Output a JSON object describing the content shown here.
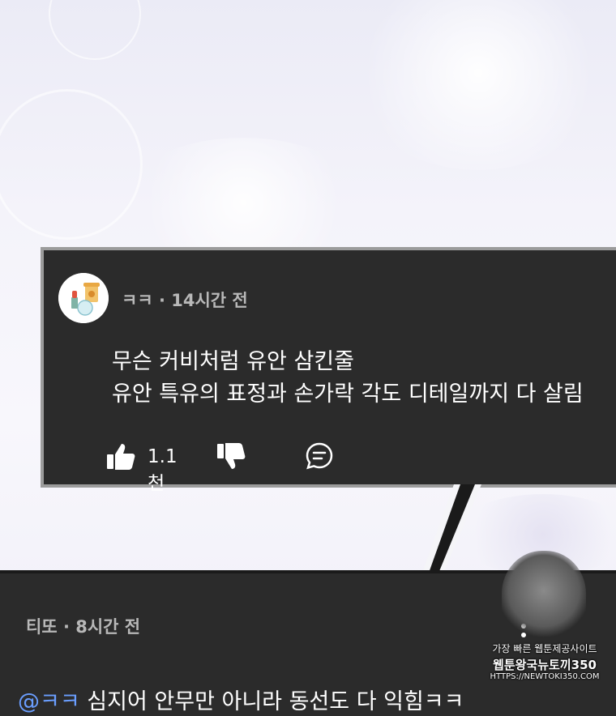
{
  "comments": [
    {
      "author": "ㅋㅋ",
      "time": "· 14시간 전",
      "lines": [
        "무슨 커비처럼 유안 삼킨줄",
        "유안 특유의 표정과 손가락 각도 디테일까지 다 살림"
      ],
      "likes": "1.1천",
      "icons": [
        "avatar-snacks-icon",
        "thumbs-up-icon",
        "thumbs-down-icon",
        "reply-bubble-icon"
      ]
    },
    {
      "author": "티또",
      "time": "· 8시간 전",
      "mention": "@ㅋㅋ",
      "reply": "심지어 안무만 아니라 동선도 다 익힘ㅋㅋ",
      "icons": [
        "more-vertical-icon"
      ]
    }
  ],
  "watermark": {
    "line1": "가장 빠른 웹툰제공사이트",
    "line2": "웹툰왕국뉴토끼350",
    "line3": "HTTPS://NEWTOKI350.COM"
  }
}
